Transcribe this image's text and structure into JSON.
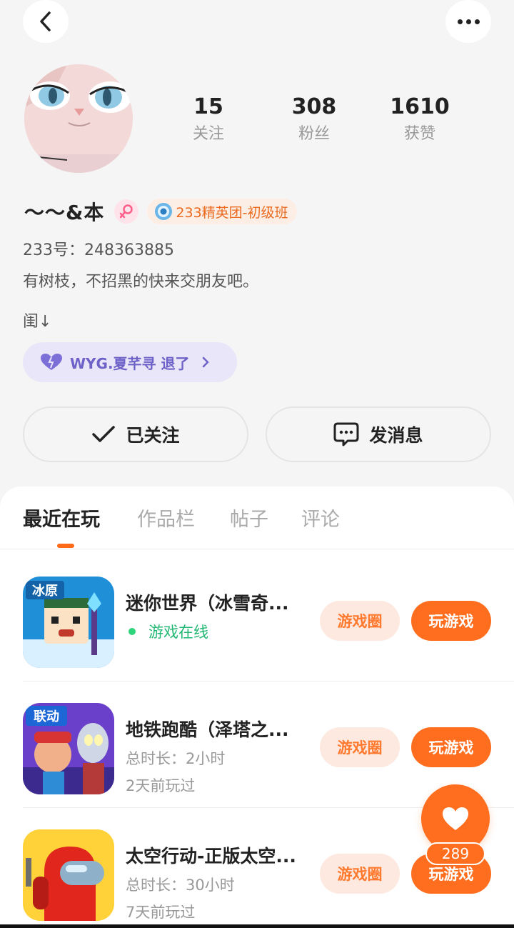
{
  "header": {
    "back_icon": "chevron-left-icon",
    "more_icon": "more-dots-icon"
  },
  "profile": {
    "stats": [
      {
        "value": "15",
        "label": "关注"
      },
      {
        "value": "308",
        "label": "粉丝"
      },
      {
        "value": "1610",
        "label": "获赞"
      }
    ],
    "nickname": "～～&本",
    "gender_icon": "female-icon",
    "rank_badge": "233精英团-初级班",
    "uid": "233号：248363885",
    "bio_line1": "有树枝，不招黑的快来交朋友吧。",
    "bio_line2": "闺↓",
    "cp_label": "WYG.夏芊寻 退了"
  },
  "actions": {
    "followed_label": "已关注",
    "message_label": "发消息"
  },
  "tabs": [
    {
      "label": "最近在玩",
      "active": true
    },
    {
      "label": "作品栏",
      "active": false
    },
    {
      "label": "帖子",
      "active": false
    },
    {
      "label": "评论",
      "active": false
    }
  ],
  "games": [
    {
      "title": "迷你世界（冰雪奇...",
      "status": "游戏在线",
      "circle_label": "游戏圈",
      "play_label": "玩游戏",
      "icon_badge": "冰原"
    },
    {
      "title": "地铁跑酷（泽塔之...",
      "duration": "总时长：2小时",
      "last_played": "2天前玩过",
      "circle_label": "游戏圈",
      "play_label": "玩游戏",
      "icon_badge": "联动"
    },
    {
      "title": "太空行动-正版太空...",
      "duration": "总时长：30小时",
      "last_played": "7天前玩过",
      "circle_label": "游戏圈",
      "play_label": "玩游戏"
    }
  ],
  "floating": {
    "like_count": "289",
    "icon": "heart-icon"
  },
  "colors": {
    "accent": "#ff6e1f",
    "online": "#22b874",
    "cp": "#6e62c8"
  }
}
